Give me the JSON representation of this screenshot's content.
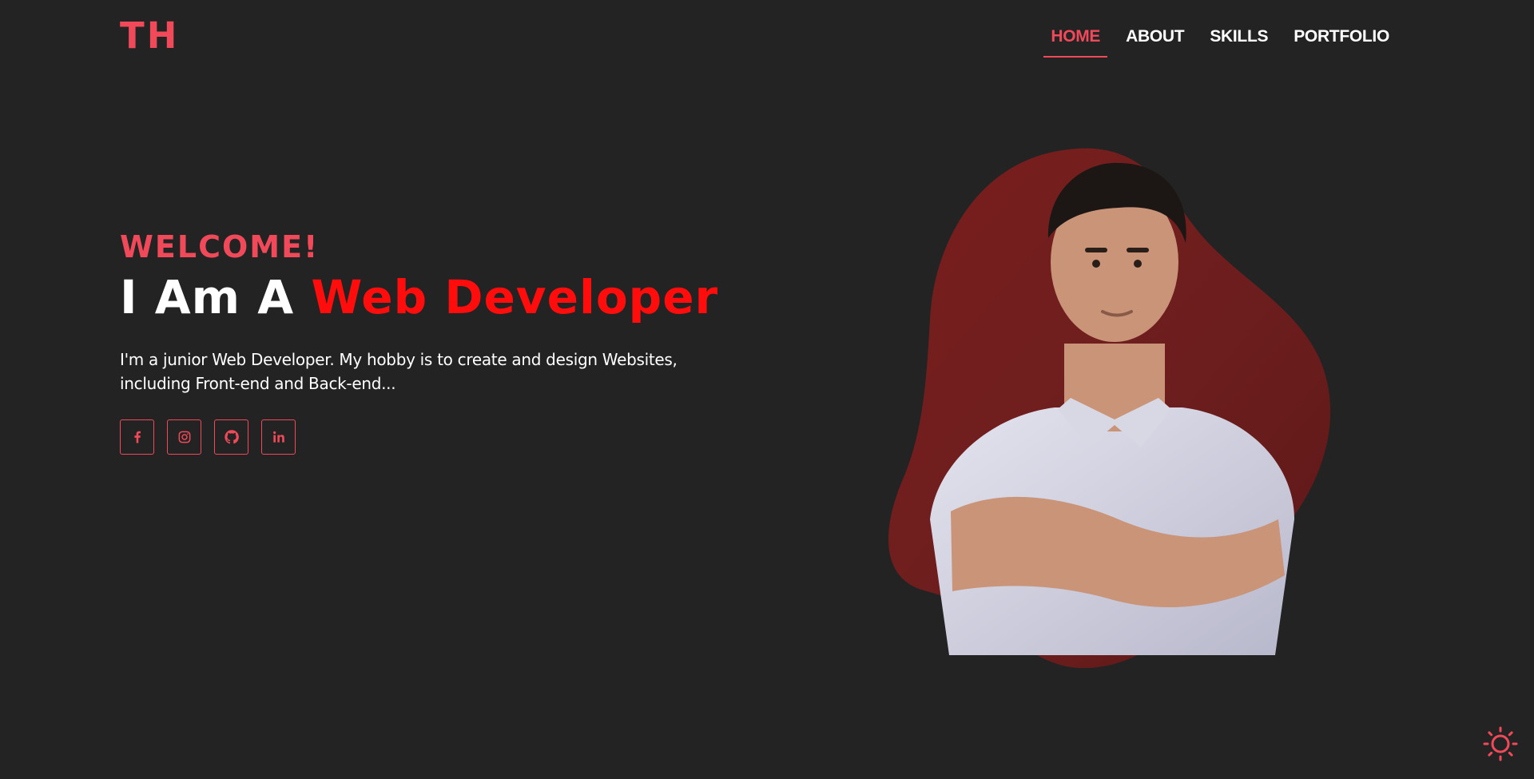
{
  "header": {
    "logo": "TH",
    "nav": [
      {
        "label": "HOME",
        "active": true
      },
      {
        "label": "ABOUT",
        "active": false
      },
      {
        "label": "SKILLS",
        "active": false
      },
      {
        "label": "PORTFOLIO",
        "active": false
      }
    ]
  },
  "hero": {
    "welcome": "WELCOME!",
    "headline_prefix": "I Am A ",
    "headline_accent": "Web Developer",
    "intro": "I'm a junior Web Developer. My hobby is to create and design Websites, including Front-end and Back-end...",
    "socials": [
      {
        "icon": "facebook-icon"
      },
      {
        "icon": "instagram-icon"
      },
      {
        "icon": "github-icon"
      },
      {
        "icon": "linkedin-icon"
      }
    ]
  },
  "theme_toggle": {
    "icon": "sun-icon"
  },
  "colors": {
    "background": "#232323",
    "accent": "#f04a5a",
    "headline_accent": "#ff0d0d",
    "blob": "#6b1d1d"
  }
}
